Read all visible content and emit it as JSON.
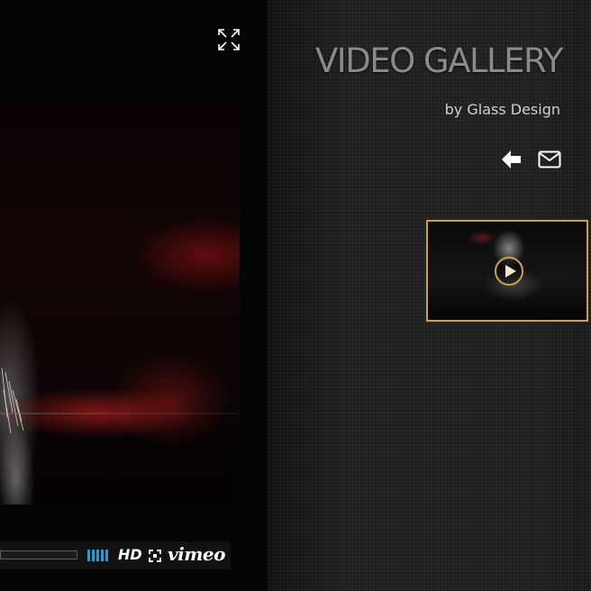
{
  "header": {
    "title": "VIDEO GALLERY",
    "subtitle": "by Glass Design"
  },
  "player": {
    "hd_label": "HD",
    "vimeo_label": "vimeo",
    "progress": 0
  },
  "icons": {
    "expand": "expand-icon",
    "back": "arrow-left-icon",
    "mail": "envelope-icon",
    "play": "play-icon",
    "volume": "volume-bars-icon",
    "fullscreen": "fullscreen-icon"
  },
  "colors": {
    "title": "#8a8a8a",
    "subtitle": "#d0d0d0",
    "thumbnail_border": "#c9a24a",
    "volume_bars": "#1e9fd8"
  }
}
